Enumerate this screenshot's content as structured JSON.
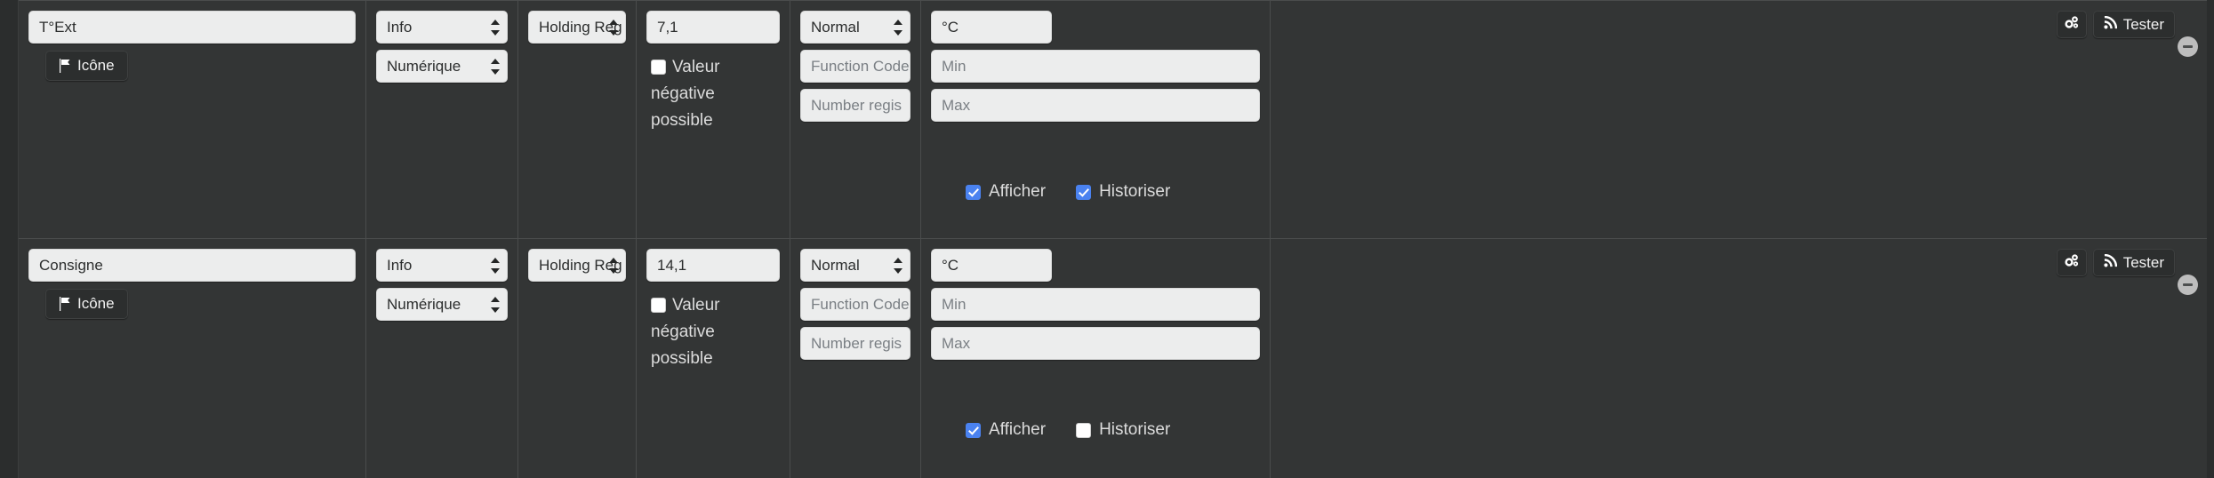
{
  "theme": {
    "background": "#333535",
    "panel": "#2c2e2e",
    "field_bg": "#eceded",
    "accent_checkbox": "#4a82f0",
    "text_light": "#dcdcdc",
    "divider": "#4a4c4c"
  },
  "icons": {
    "flag": "flag-icon",
    "gears": "gears-icon",
    "signal": "signal-icon",
    "minus": "minus-circle-icon"
  },
  "labels": {
    "icon_button": "Icône",
    "tester_button": "Tester",
    "negative_value": "Valeur négative possible",
    "show": "Afficher",
    "historize": "Historiser"
  },
  "placeholders": {
    "function_code": "Function Code",
    "number_register": "Number regis",
    "min": "Min",
    "max": "Max"
  },
  "rows": [
    {
      "name": "T°Ext",
      "type": "Info",
      "subtype": "Numérique",
      "register": "Holding Reg",
      "value": "7,1",
      "endianness": "Normal",
      "function_code": "",
      "number_register": "",
      "unit": "°C",
      "min": "",
      "max": "",
      "negative_allowed": false,
      "show": true,
      "historize": true
    },
    {
      "name": "Consigne",
      "type": "Info",
      "subtype": "Numérique",
      "register": "Holding Reg",
      "value": "14,1",
      "endianness": "Normal",
      "function_code": "",
      "number_register": "",
      "unit": "°C",
      "min": "",
      "max": "",
      "negative_allowed": false,
      "show": true,
      "historize": false
    }
  ]
}
